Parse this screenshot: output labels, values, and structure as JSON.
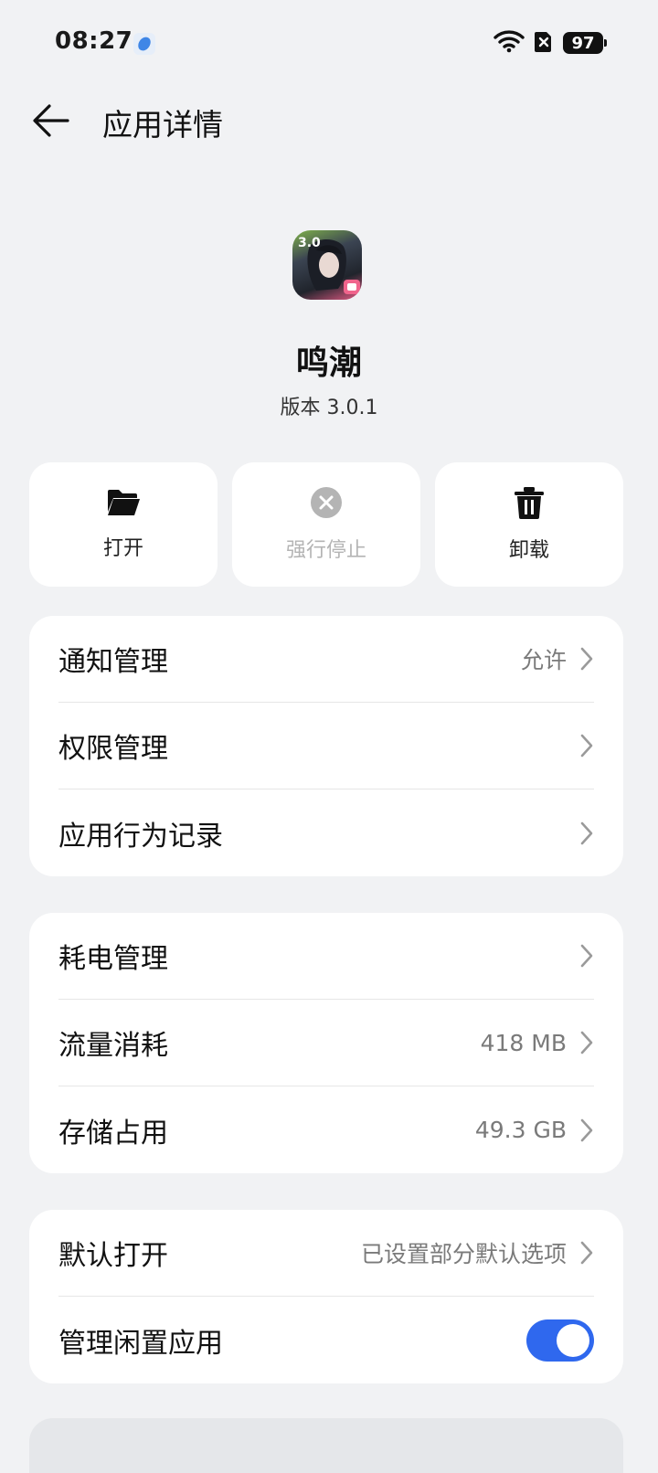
{
  "status_bar": {
    "time": "08:27",
    "battery": "97"
  },
  "header": {
    "title": "应用详情"
  },
  "app": {
    "name": "鸣潮",
    "version": "版本 3.0.1"
  },
  "actions": [
    {
      "label": "打开",
      "icon": "folder-open-icon",
      "enabled": true
    },
    {
      "label": "强行停止",
      "icon": "close-circle-icon",
      "enabled": false
    },
    {
      "label": "卸载",
      "icon": "trash-icon",
      "enabled": true
    }
  ],
  "group1": [
    {
      "label": "通知管理",
      "value": "允许"
    },
    {
      "label": "权限管理",
      "value": ""
    },
    {
      "label": "应用行为记录",
      "value": ""
    }
  ],
  "group2": [
    {
      "label": "耗电管理",
      "value": ""
    },
    {
      "label": "流量消耗",
      "value": "418 MB"
    },
    {
      "label": "存储占用",
      "value": "49.3 GB"
    }
  ],
  "group3": [
    {
      "label": "默认打开",
      "value": "已设置部分默认选项"
    },
    {
      "label": "管理闲置应用",
      "toggle": true
    }
  ],
  "colors": {
    "accent": "#2f68ee",
    "background": "#f1f2f4",
    "card": "#ffffff"
  }
}
